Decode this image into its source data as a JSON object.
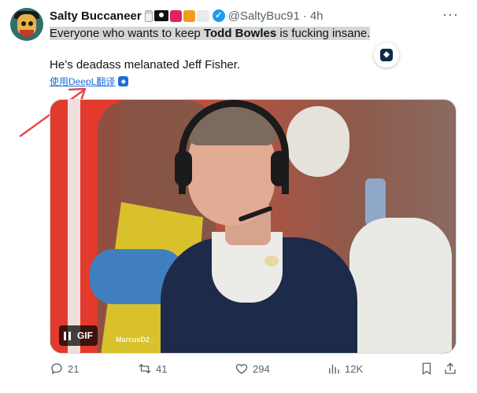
{
  "tweet": {
    "display_name": "Salty Buccaneer",
    "handle": "@SaltyBuc91",
    "separator": "·",
    "time": "4h",
    "line1": {
      "before": "Everyone who wants to keep ",
      "bold": "Todd Bowles",
      "after": " is fucking insane."
    },
    "line2": "He’s deadass melanated Jeff Fisher.",
    "translate_label": "使用DeepL翻译"
  },
  "media": {
    "type": "GIF",
    "gif_label": "GIF",
    "watermark": "MarcusD2_"
  },
  "actions": {
    "replies": "21",
    "retweets": "41",
    "likes": "294",
    "views": "12K"
  },
  "icons": {
    "verified": "verified-check-icon",
    "more": "more-icon",
    "deepl": "deepl-icon",
    "reply": "reply-icon",
    "retweet": "retweet-icon",
    "like": "heart-icon",
    "views": "views-bar-chart-icon",
    "bookmark": "bookmark-icon",
    "share": "share-icon"
  },
  "colors": {
    "text": "#0f1419",
    "secondary": "#536471",
    "verified": "#1d9bf0",
    "link": "#1d6fd6",
    "annotation_arrow": "#e5484d",
    "highlight": "#d6d6d6"
  }
}
